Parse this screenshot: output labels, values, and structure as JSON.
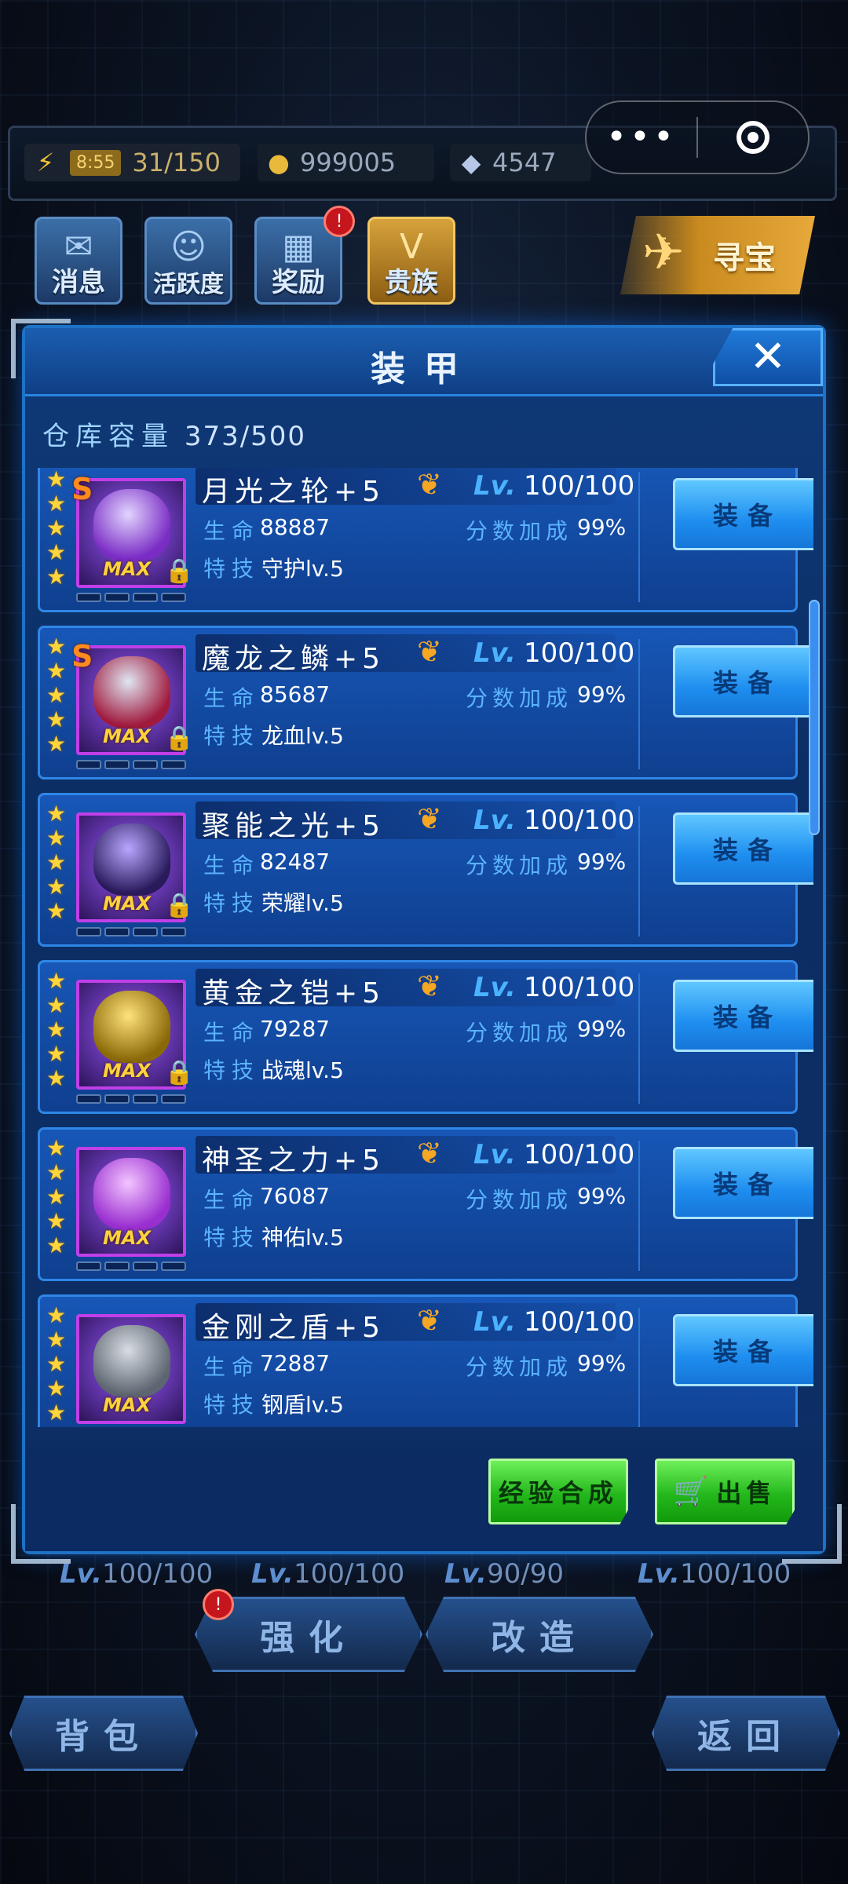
{
  "resources": {
    "energy_timer": "8:55",
    "energy": "31/150",
    "gold": "999005",
    "gems": "4547"
  },
  "capsule": {
    "more_icon": "more-dots-icon",
    "close_icon": "target-icon"
  },
  "menu": {
    "messages": "消息",
    "activity": "活跃度",
    "rewards": "奖励",
    "rewards_badge": "!",
    "noble": "贵族",
    "treasure": "寻宝"
  },
  "background": {
    "lv_label": "Lv.",
    "levels": [
      "100/100",
      "100/100",
      "90/90",
      "100/100"
    ],
    "strengthen": "强化",
    "strengthen_badge": "!",
    "modify": "改造",
    "bag": "背包",
    "back": "返回"
  },
  "modal": {
    "title": "装甲",
    "close": "✕",
    "capacity_label": "仓库容量",
    "capacity_value": "373/500",
    "items": [
      {
        "name": "月光之轮+5",
        "rank": "S",
        "level_label": "Lv.",
        "level": "100/100",
        "hp_label": "生命",
        "hp": "88887",
        "bonus_label": "分数加成",
        "bonus": "99%",
        "skill_label": "特技",
        "skill": "守护lv.5",
        "max": "MAX",
        "locked": true,
        "equip": "装备",
        "colors": [
          "#e1d4ff",
          "#7a2cc4"
        ]
      },
      {
        "name": "魔龙之鳞+5",
        "rank": "S",
        "level_label": "Lv.",
        "level": "100/100",
        "hp_label": "生命",
        "hp": "85687",
        "bonus_label": "分数加成",
        "bonus": "99%",
        "skill_label": "特技",
        "skill": "龙血lv.5",
        "max": "MAX",
        "locked": true,
        "equip": "装备",
        "colors": [
          "#dfe6f2",
          "#a01a3e"
        ]
      },
      {
        "name": "聚能之光+5",
        "rank": "",
        "level_label": "Lv.",
        "level": "100/100",
        "hp_label": "生命",
        "hp": "82487",
        "bonus_label": "分数加成",
        "bonus": "99%",
        "skill_label": "特技",
        "skill": "荣耀lv.5",
        "max": "MAX",
        "locked": true,
        "equip": "装备",
        "colors": [
          "#b9a6ff",
          "#2a1a5c"
        ]
      },
      {
        "name": "黄金之铠+5",
        "rank": "",
        "level_label": "Lv.",
        "level": "100/100",
        "hp_label": "生命",
        "hp": "79287",
        "bonus_label": "分数加成",
        "bonus": "99%",
        "skill_label": "特技",
        "skill": "战魂lv.5",
        "max": "MAX",
        "locked": true,
        "equip": "装备",
        "colors": [
          "#ffe27a",
          "#8a6a08"
        ]
      },
      {
        "name": "神圣之力+5",
        "rank": "",
        "level_label": "Lv.",
        "level": "100/100",
        "hp_label": "生命",
        "hp": "76087",
        "bonus_label": "分数加成",
        "bonus": "99%",
        "skill_label": "特技",
        "skill": "神佑lv.5",
        "max": "MAX",
        "locked": false,
        "equip": "装备",
        "colors": [
          "#f3c4ff",
          "#9a2fd0"
        ]
      },
      {
        "name": "金刚之盾+5",
        "rank": "",
        "level_label": "Lv.",
        "level": "100/100",
        "hp_label": "生命",
        "hp": "72887",
        "bonus_label": "分数加成",
        "bonus": "99%",
        "skill_label": "特技",
        "skill": "钢盾lv.5",
        "max": "MAX",
        "locked": false,
        "equip": "装备",
        "colors": [
          "#d8dde4",
          "#5d6670"
        ]
      }
    ],
    "exp_merge": "经验合成",
    "sell": "出售"
  }
}
